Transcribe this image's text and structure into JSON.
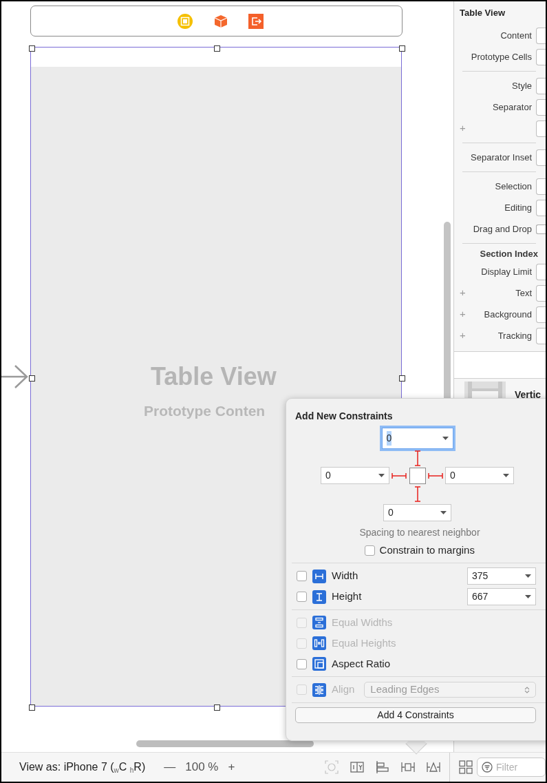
{
  "canvas": {
    "table_title": "Table View",
    "table_subtitle": "Prototype Conten"
  },
  "inspector": {
    "title": "Table View",
    "rows": [
      {
        "kind": "field",
        "label": "Content"
      },
      {
        "kind": "field",
        "label": "Prototype Cells"
      },
      {
        "kind": "separator"
      },
      {
        "kind": "field",
        "label": "Style"
      },
      {
        "kind": "field",
        "label": "Separator"
      },
      {
        "kind": "field",
        "plus": "+"
      },
      {
        "kind": "separator"
      },
      {
        "kind": "field",
        "label": "Separator Inset"
      },
      {
        "kind": "separator"
      },
      {
        "kind": "field",
        "label": "Selection"
      },
      {
        "kind": "field",
        "label": "Editing"
      },
      {
        "kind": "checkbox",
        "label": "Drag and Drop",
        "checked": false
      },
      {
        "kind": "separator"
      },
      {
        "kind": "heading",
        "label": "Section Index"
      },
      {
        "kind": "field",
        "label": "Display Limit"
      },
      {
        "kind": "field",
        "plus": "+",
        "label": "Text"
      },
      {
        "kind": "field",
        "plus": "+",
        "label": "Background"
      },
      {
        "kind": "field",
        "plus": "+",
        "label": "Tracking"
      }
    ],
    "library_item": "Vertic",
    "filter": {
      "placeholder": "Filter"
    }
  },
  "popover": {
    "title": "Add New Constraints",
    "spacing": {
      "top": {
        "value": "0",
        "selected": true
      },
      "left": {
        "value": "0",
        "selected": false
      },
      "right": {
        "value": "0",
        "selected": false
      },
      "bottom": {
        "value": "0",
        "selected": false
      }
    },
    "spacing_label": "Spacing to nearest neighbor",
    "margins": {
      "label": "Constrain to margins",
      "checked": false
    },
    "size": [
      {
        "kind": "width",
        "label": "Width",
        "checked": false,
        "value": "375"
      },
      {
        "kind": "height",
        "label": "Height",
        "checked": false,
        "value": "667"
      }
    ],
    "relations": [
      {
        "kind": "equalwidths",
        "label": "Equal Widths",
        "checked": false,
        "disabled": true
      },
      {
        "kind": "equalheights",
        "label": "Equal Heights",
        "checked": false,
        "disabled": true
      },
      {
        "kind": "aspect",
        "label": "Aspect Ratio",
        "checked": false,
        "disabled": false
      }
    ],
    "align": {
      "label": "Align",
      "checked": false,
      "disabled": true,
      "value": "Leading Edges"
    },
    "button": "Add 4 Constraints"
  },
  "bottom_bar": {
    "view_as": "View as: iPhone 7 ($_{w}$C $_{h}$R)",
    "zoom_out": "—",
    "zoom": "100 %",
    "zoom_in": "+"
  }
}
